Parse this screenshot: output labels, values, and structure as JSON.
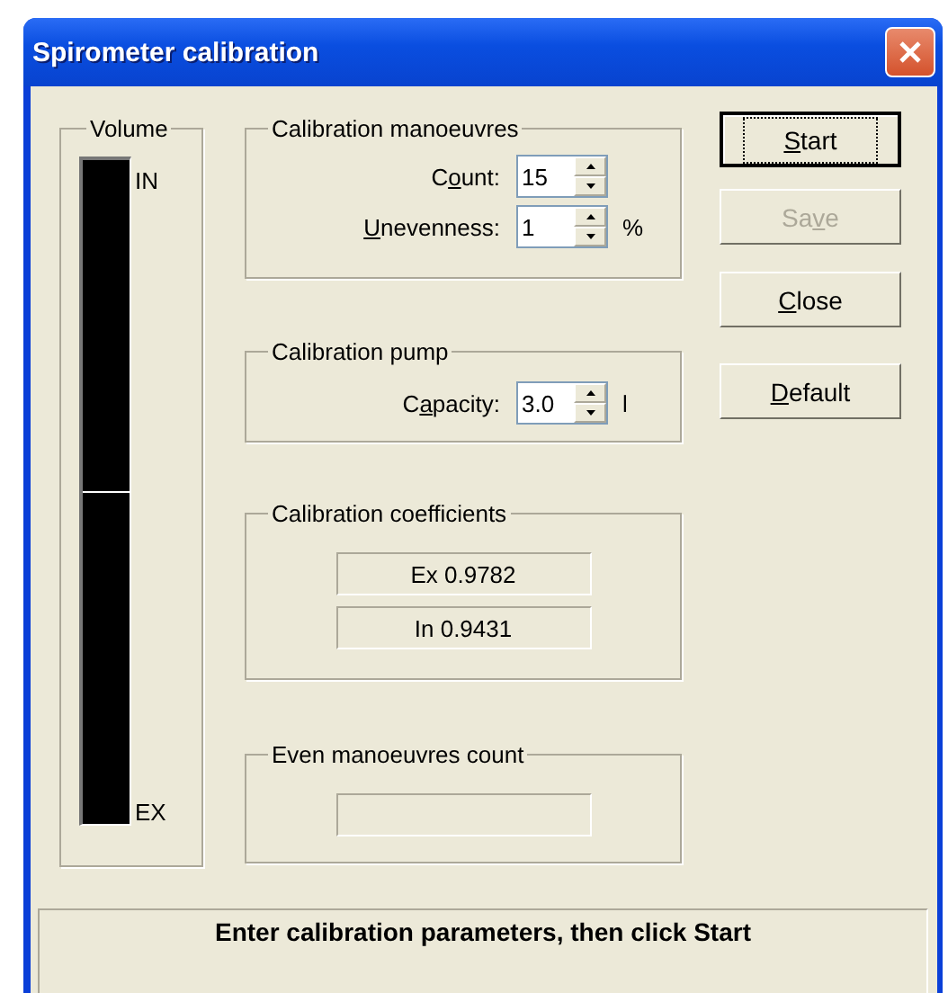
{
  "window": {
    "title": "Spirometer calibration"
  },
  "volume": {
    "title": "Volume",
    "top_label": "IN",
    "bottom_label": "EX",
    "level": 0.5
  },
  "manoeuvres": {
    "title": "Calibration manoeuvres",
    "fields": [
      {
        "label": {
          "pre": "C",
          "key": "o",
          "post": "unt:"
        },
        "value": "15"
      },
      {
        "label": {
          "key": "U",
          "post": "nevenness:"
        },
        "value": "1",
        "unit": "%"
      }
    ]
  },
  "pump": {
    "title": "Calibration pump",
    "fields": [
      {
        "label": {
          "pre": "C",
          "key": "a",
          "post": "pacity:"
        },
        "value": "3.0",
        "unit": "l"
      }
    ]
  },
  "coefficients": {
    "title": "Calibration coefficients",
    "values": [
      "Ex  0.9782",
      "In  0.9431"
    ]
  },
  "even": {
    "title": "Even manoeuvres count"
  },
  "buttons": [
    {
      "label": {
        "key": "S",
        "post": "tart"
      },
      "disabled": false,
      "default": true
    },
    {
      "label": {
        "pre": "Sa",
        "key": "v",
        "post": "e"
      },
      "disabled": true,
      "default": false
    },
    {
      "label": {
        "key": "C",
        "post": "lose"
      },
      "disabled": false,
      "default": false
    },
    {
      "label": {
        "key": "D",
        "post": "efault"
      },
      "disabled": false,
      "default": false
    }
  ],
  "status_bar": "Enter calibration parameters, then click Start"
}
